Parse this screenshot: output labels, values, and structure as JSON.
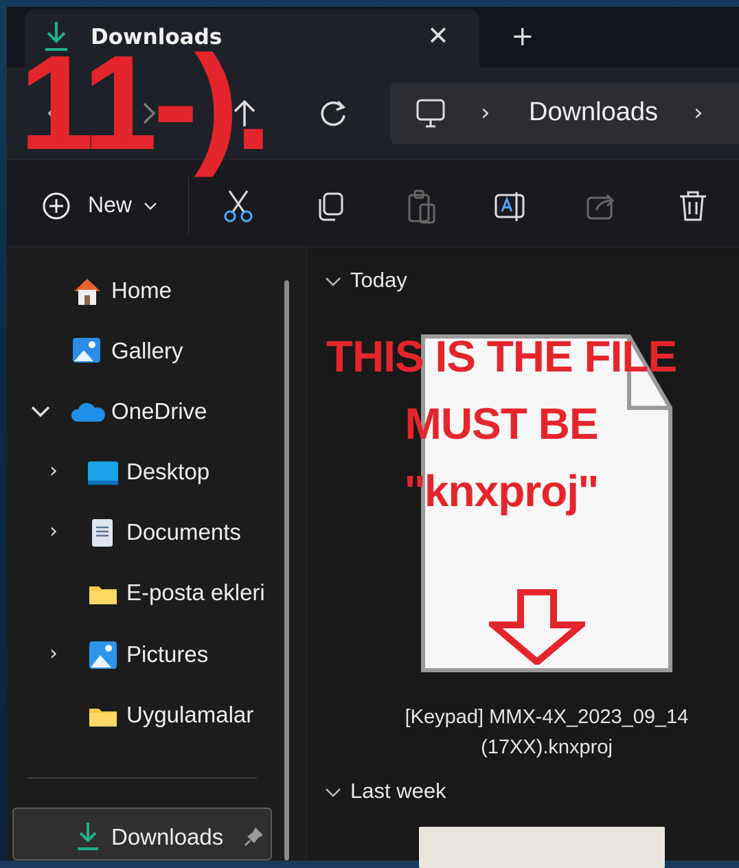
{
  "window": {
    "tab": {
      "title": "Downloads",
      "close_symbol": "✕",
      "new_tab_symbol": "+"
    },
    "address_bar": {
      "location": "Downloads"
    }
  },
  "toolbar": {
    "new_label": "New",
    "actions": [
      "cut-icon",
      "copy-icon",
      "paste-icon",
      "rename-icon",
      "share-icon",
      "delete-icon"
    ]
  },
  "sidebar": {
    "items": [
      {
        "label": "Home",
        "icon": "home-icon"
      },
      {
        "label": "Gallery",
        "icon": "gallery-icon"
      },
      {
        "label": "OneDrive",
        "icon": "onedrive-icon",
        "expanded": true
      },
      {
        "label": "Desktop",
        "icon": "desktop-folder-icon"
      },
      {
        "label": "Documents",
        "icon": "documents-folder-icon"
      },
      {
        "label": "E-posta ekleri",
        "icon": "folder-icon"
      },
      {
        "label": "Pictures",
        "icon": "pictures-folder-icon"
      },
      {
        "label": "Uygulamalar",
        "icon": "folder-icon"
      }
    ],
    "pinned": {
      "label": "Downloads",
      "icon": "download-icon",
      "pin": "pin-icon"
    }
  },
  "content": {
    "groups": [
      {
        "header": "Today",
        "file": {
          "name_line1": "[Keypad] MMX-4X_2023_09_14",
          "name_line2": "(17XX).knxproj"
        }
      },
      {
        "header": "Last week"
      }
    ]
  },
  "annotations": {
    "step": "11-).",
    "note_line1": "THIS IS THE FILE",
    "note_line2": "MUST BE",
    "note_line3": "''knxproj''",
    "color": "#e4262c"
  }
}
